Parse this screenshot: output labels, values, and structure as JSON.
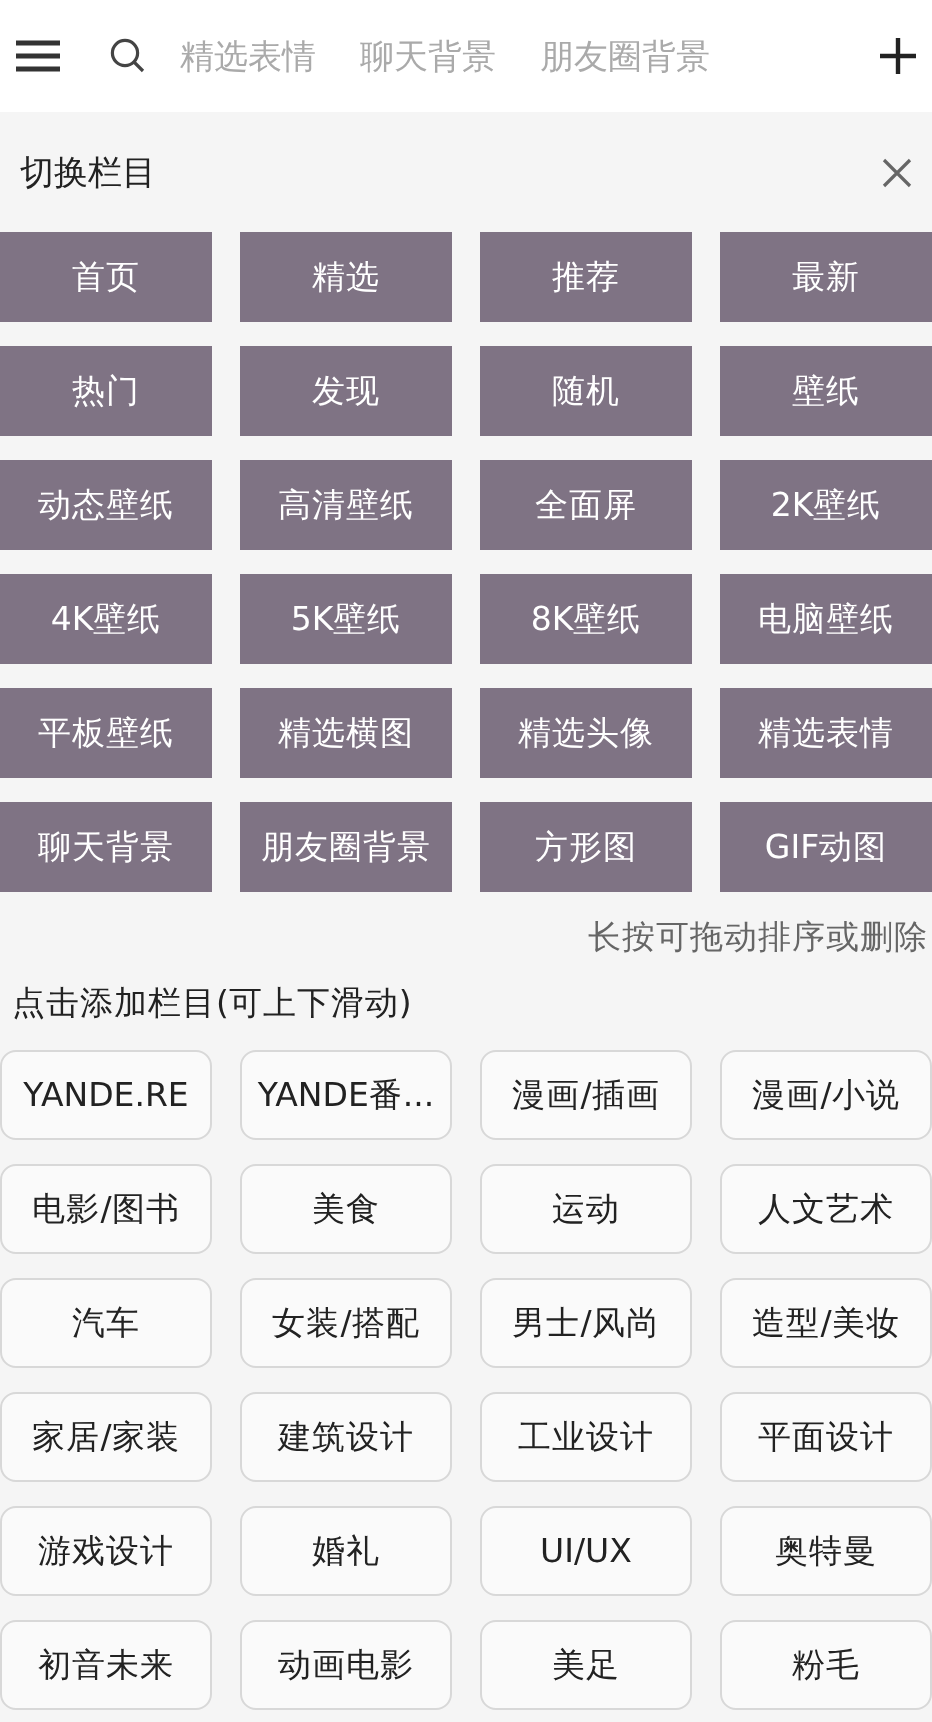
{
  "top_bar": {
    "tabs": [
      {
        "label": "精选表情",
        "selected": false
      },
      {
        "label": "聊天背景",
        "selected": false
      },
      {
        "label": "朋友圈背景",
        "selected": false
      }
    ]
  },
  "panel": {
    "title": "切换栏目",
    "my_columns": [
      "首页",
      "精选",
      "推荐",
      "最新",
      "热门",
      "发现",
      "随机",
      "壁纸",
      "动态壁纸",
      "高清壁纸",
      "全面屏",
      "2K壁纸",
      "4K壁纸",
      "5K壁纸",
      "8K壁纸",
      "电脑壁纸",
      "平板壁纸",
      "精选横图",
      "精选头像",
      "精选表情",
      "聊天背景",
      "朋友圈背景",
      "方形图",
      "GIF动图"
    ],
    "hint": "长按可拖动排序或删除",
    "add_title": "点击添加栏目(可上下滑动)",
    "more_columns": [
      "YANDE.RE",
      "YANDE番...",
      "漫画/插画",
      "漫画/小说",
      "电影/图书",
      "美食",
      "运动",
      "人文艺术",
      "汽车",
      "女装/搭配",
      "男士/风尚",
      "造型/美妆",
      "家居/家装",
      "建筑设计",
      "工业设计",
      "平面设计",
      "游戏设计",
      "婚礼",
      "UI/UX",
      "奥特曼",
      "初音未来",
      "动画电影",
      "美足",
      "粉毛"
    ]
  }
}
